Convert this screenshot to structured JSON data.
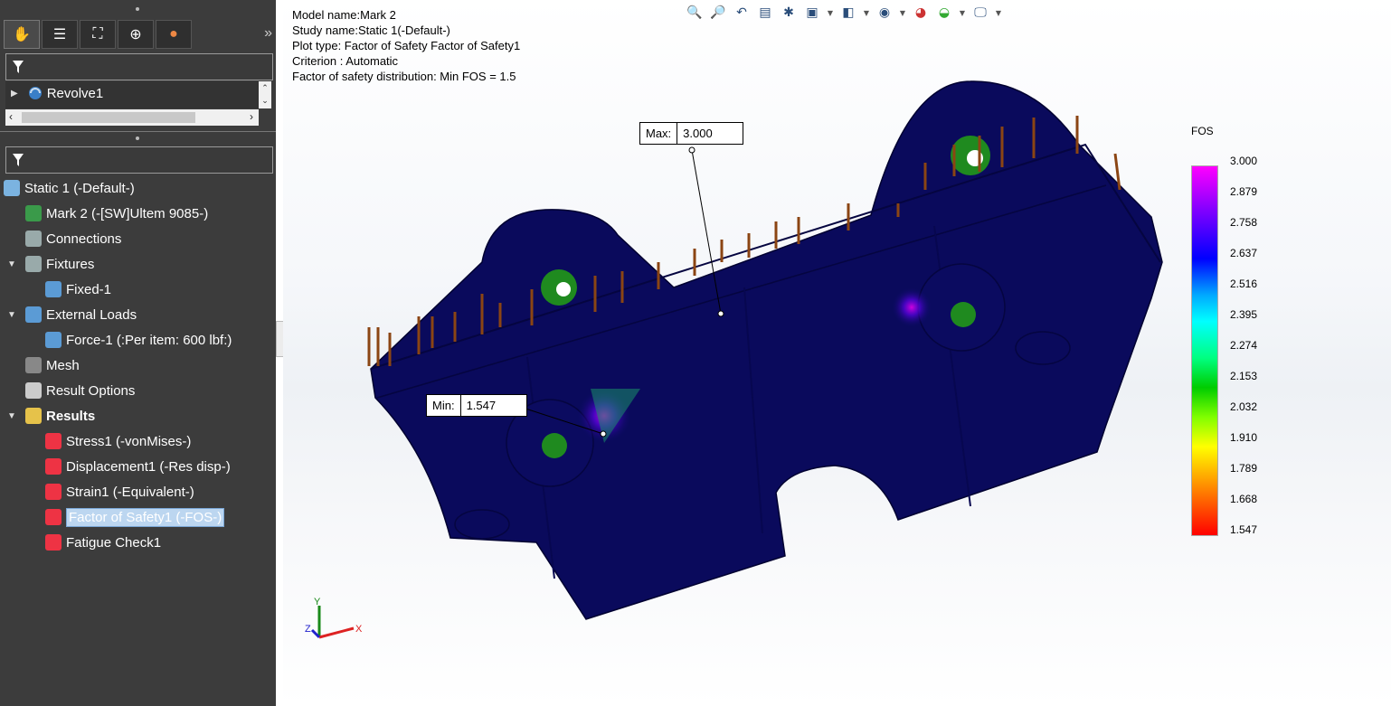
{
  "left_panel": {
    "top_tree": {
      "item": "Revolve1"
    },
    "sim_tree": [
      {
        "label": "Static 1 (-Default-)",
        "icon": "study-icon",
        "indent": 0,
        "caret": ""
      },
      {
        "label": "Mark 2 (-[SW]Ultem 9085-)",
        "icon": "part-icon",
        "indent": 1,
        "caret": ""
      },
      {
        "label": "Connections",
        "icon": "connections-icon",
        "indent": 1,
        "caret": ""
      },
      {
        "label": "Fixtures",
        "icon": "fixtures-icon",
        "indent": 1,
        "caret": "▼"
      },
      {
        "label": "Fixed-1",
        "icon": "fixed-icon",
        "indent": 2,
        "caret": ""
      },
      {
        "label": "External Loads",
        "icon": "external-loads-icon",
        "indent": 1,
        "caret": "▼"
      },
      {
        "label": "Force-1 (:Per item: 600 lbf:)",
        "icon": "force-icon",
        "indent": 2,
        "caret": ""
      },
      {
        "label": "Mesh",
        "icon": "mesh-icon",
        "indent": 1,
        "caret": ""
      },
      {
        "label": "Result Options",
        "icon": "result-options-icon",
        "indent": 1,
        "caret": ""
      },
      {
        "label": "Results",
        "icon": "results-folder-icon",
        "indent": 1,
        "caret": "▼",
        "bold": true
      },
      {
        "label": "Stress1 (-vonMises-)",
        "icon": "stress-plot-icon",
        "indent": 2,
        "caret": ""
      },
      {
        "label": "Displacement1 (-Res disp-)",
        "icon": "displacement-plot-icon",
        "indent": 2,
        "caret": ""
      },
      {
        "label": "Strain1 (-Equivalent-)",
        "icon": "strain-plot-icon",
        "indent": 2,
        "caret": ""
      },
      {
        "label": "Factor of Safety1 (-FOS-)",
        "icon": "fos-plot-icon",
        "indent": 2,
        "caret": "",
        "selected": true
      },
      {
        "label": "Fatigue Check1",
        "icon": "fatigue-icon",
        "indent": 2,
        "caret": ""
      }
    ]
  },
  "viewport": {
    "info_lines": [
      "Model name:Mark 2",
      "Study name:Static 1(-Default-)",
      "Plot type: Factor of Safety Factor of Safety1",
      "Criterion : Automatic",
      "Factor of safety distribution: Min FOS  =  1.5"
    ],
    "probe_max": {
      "key": "Max:",
      "value": "3.000"
    },
    "probe_min": {
      "key": "Min:",
      "value": "1.547"
    },
    "legend": {
      "title": "FOS",
      "ticks": [
        "3.000",
        "2.879",
        "2.758",
        "2.637",
        "2.516",
        "2.395",
        "2.274",
        "2.153",
        "2.032",
        "1.910",
        "1.789",
        "1.668",
        "1.547"
      ]
    },
    "triad": {
      "x": "X",
      "y": "Y",
      "z": "Z"
    }
  }
}
